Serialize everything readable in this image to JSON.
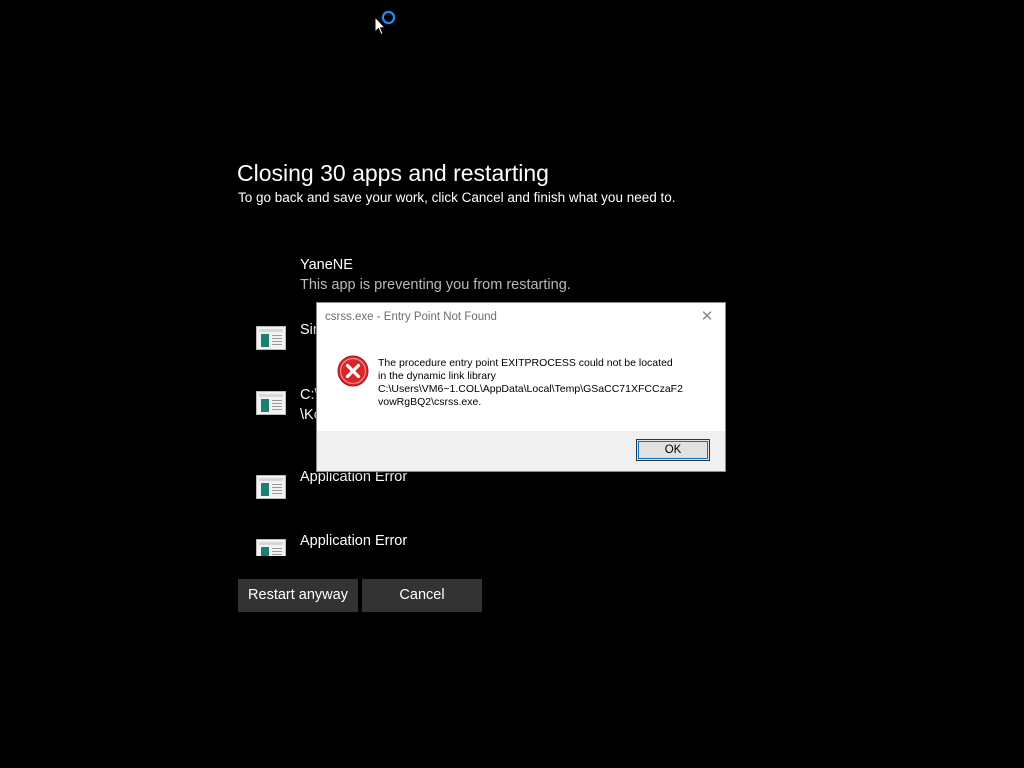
{
  "screen": {
    "title": "Closing 30 apps and restarting",
    "subtitle": "To go back and save your work, click Cancel and finish what you need to."
  },
  "apps": [
    {
      "name": "YaneNE",
      "description": "This app is preventing you from restarting.",
      "icon": "none"
    },
    {
      "name": "Sir",
      "icon": "app-window-icon"
    },
    {
      "name_line1": "C:\\",
      "name_line2": "\\Kc",
      "icon": "app-window-icon"
    },
    {
      "name": "Application Error",
      "icon": "app-window-icon"
    },
    {
      "name": "Application Error",
      "icon": "app-window-icon"
    }
  ],
  "buttons": {
    "restart": "Restart anyway",
    "cancel": "Cancel"
  },
  "dialog": {
    "title": "csrss.exe - Entry Point Not Found",
    "close_glyph": "✕",
    "message_lines": [
      "The procedure entry point EXITPROCESS could not be located",
      "in the dynamic link library",
      "C:\\Users\\VM6~1.COL\\AppData\\Local\\Temp\\GSaCC71XFCCzaF2",
      "vowRgBQ2\\csrss.exe."
    ],
    "ok_label": "OK",
    "icon": "error-icon"
  },
  "colors": {
    "background": "#000000",
    "button_bg": "#333333",
    "accent": "#0078d7",
    "error_red": "#d9262b"
  }
}
